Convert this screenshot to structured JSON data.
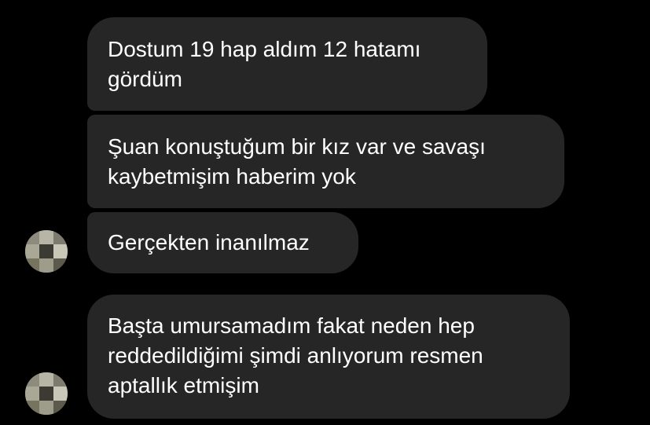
{
  "messages": [
    {
      "text": "Dostum 19 hap aldım 12 hatamı\ngördüm"
    },
    {
      "text": "Şuan konuştuğum bir kız var ve savaşı\nkaybetmişim haberim yok"
    },
    {
      "text": "Gerçekten inanılmaz"
    },
    {
      "text": "Başta umursamadım fakat neden hep\nreddedildiğimi şimdi anlıyorum resmen\naptallık etmişim"
    }
  ],
  "colors": {
    "background": "#000000",
    "bubble": "#262626",
    "text": "#ffffff"
  }
}
